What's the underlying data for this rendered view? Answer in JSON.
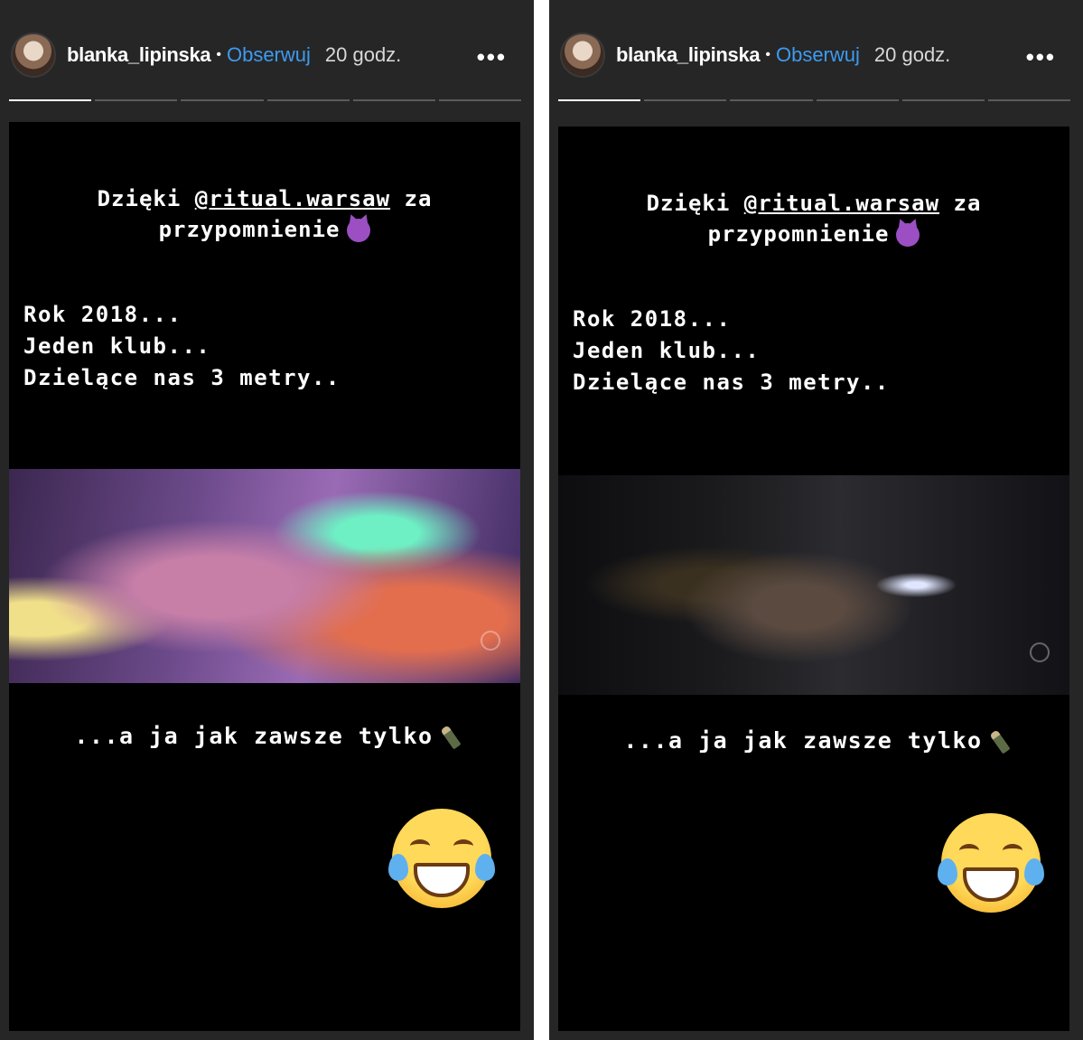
{
  "stories": [
    {
      "header": {
        "username": "blanka_lipinska",
        "separator": "•",
        "follow_label": "Obserwuj",
        "time": "20 godz.",
        "more_label": "•••"
      },
      "progress": {
        "segments": 6,
        "active_index": 0
      },
      "content": {
        "thanks_prefix": "Dzięki ",
        "mention": "@ritual.warsaw",
        "thanks_suffix": " za",
        "thanks_line2": "przypomnienie",
        "line1": "Rok 2018...",
        "line2": "Jeden klub...",
        "line3": "Dzielące nas 3 metry..",
        "caption": "...a ja jak zawsze tylko",
        "emojis": [
          "smiling-devil-emoji",
          "champagne-bottle-emoji",
          "tears-of-joy-emoji"
        ]
      }
    },
    {
      "header": {
        "username": "blanka_lipinska",
        "separator": "•",
        "follow_label": "Obserwuj",
        "time": "20 godz.",
        "more_label": "•••"
      },
      "progress": {
        "segments": 6,
        "active_index": 0
      },
      "content": {
        "thanks_prefix": "Dzięki ",
        "mention": "@ritual.warsaw",
        "thanks_suffix": " za",
        "thanks_line2": "przypomnienie",
        "line1": "Rok 2018...",
        "line2": "Jeden klub...",
        "line3": "Dzielące nas 3 metry..",
        "caption": "...a ja jak zawsze tylko",
        "emojis": [
          "smiling-devil-emoji",
          "champagne-bottle-emoji",
          "tears-of-joy-emoji"
        ]
      }
    }
  ],
  "colors": {
    "panel_bg": "#262626",
    "story_bg": "#000000",
    "follow_blue": "#3d9bf0",
    "text": "#ffffff"
  }
}
